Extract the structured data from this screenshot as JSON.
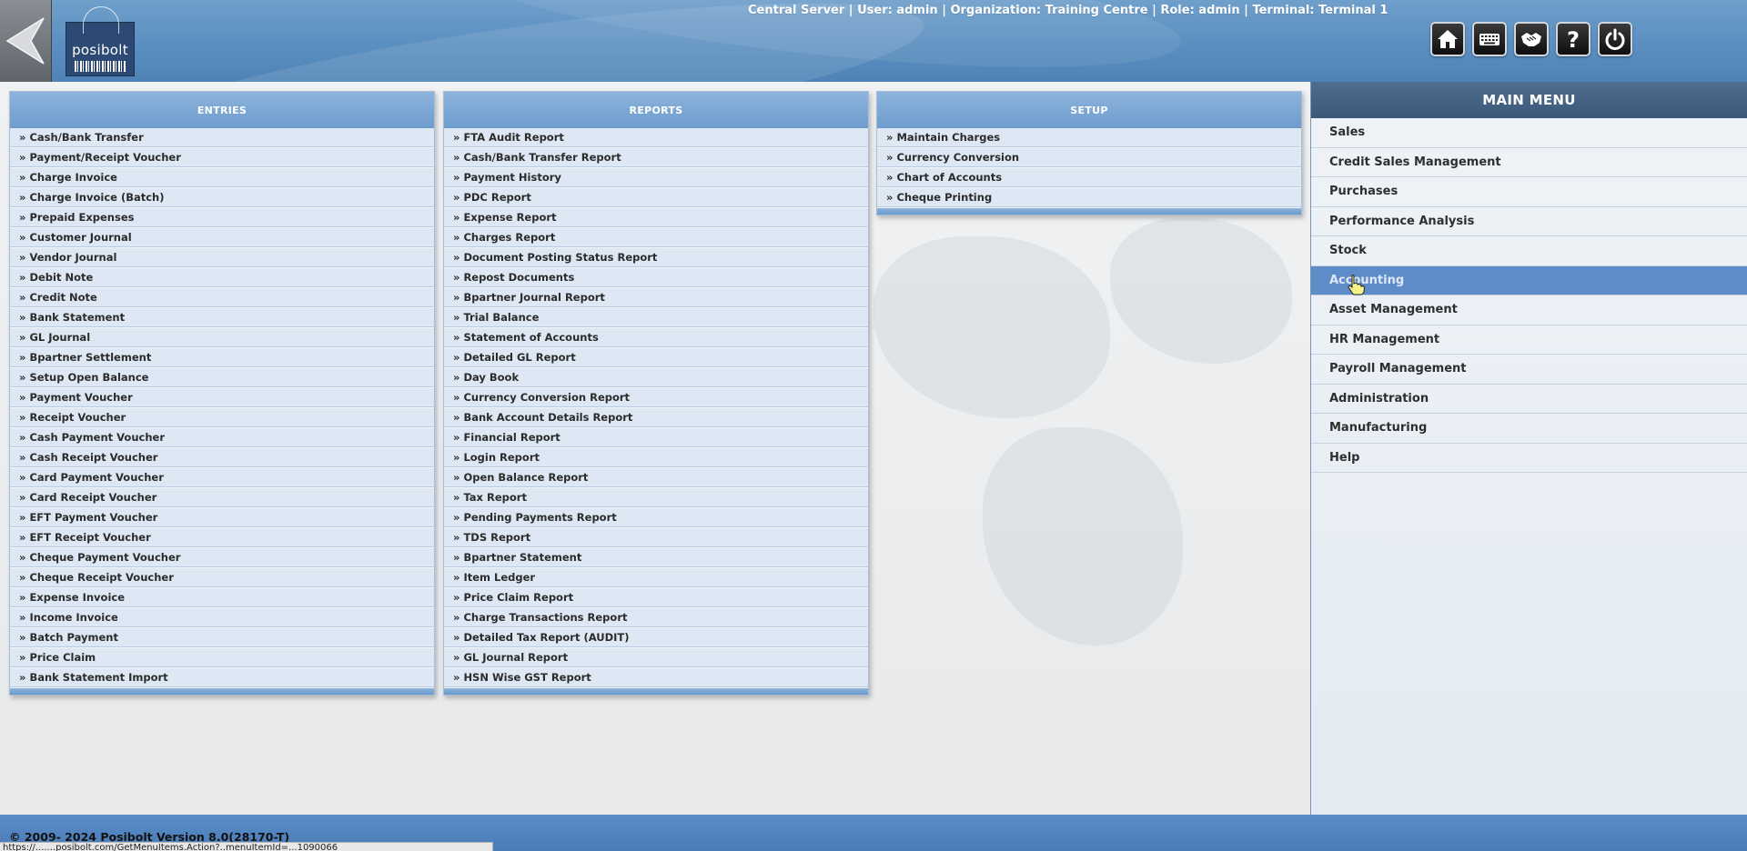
{
  "header": {
    "session_info": "Central Server | User: admin | Organization: Training Centre | Role: admin | Terminal: Terminal 1",
    "logo_text": "posibolt",
    "toolbar": [
      {
        "icon": "home-icon"
      },
      {
        "icon": "keyboard-icon"
      },
      {
        "icon": "handshake-icon"
      },
      {
        "icon": "help-icon"
      },
      {
        "icon": "power-icon"
      }
    ]
  },
  "panels": {
    "entries": {
      "title": "ENTRIES",
      "items": [
        "Cash/Bank Transfer",
        "Payment/Receipt Voucher",
        "Charge Invoice",
        "Charge Invoice (Batch)",
        "Prepaid Expenses",
        "Customer Journal",
        "Vendor Journal",
        "Debit Note",
        "Credit Note",
        "Bank Statement",
        "GL Journal",
        "Bpartner Settlement",
        "Setup Open Balance",
        "Payment Voucher",
        "Receipt Voucher",
        "Cash Payment Voucher",
        "Cash Receipt Voucher",
        "Card Payment Voucher",
        "Card Receipt Voucher",
        "EFT Payment Voucher",
        "EFT Receipt Voucher",
        "Cheque Payment Voucher",
        "Cheque Receipt Voucher",
        "Expense Invoice",
        "Income Invoice",
        "Batch Payment",
        "Price Claim",
        "Bank Statement Import"
      ]
    },
    "reports": {
      "title": "REPORTS",
      "items": [
        "FTA Audit Report",
        "Cash/Bank Transfer Report",
        "Payment History",
        "PDC Report",
        "Expense Report",
        "Charges Report",
        "Document Posting Status Report",
        "Repost Documents",
        "Bpartner Journal Report",
        "Trial Balance",
        "Statement of Accounts",
        "Detailed GL Report",
        "Day Book",
        "Currency Conversion Report",
        "Bank Account Details Report",
        "Financial Report",
        "Login Report",
        "Open Balance Report",
        "Tax Report",
        "Pending Payments Report",
        "TDS Report",
        "Bpartner Statement",
        "Item Ledger",
        "Price Claim Report",
        "Charge Transactions Report",
        "Detailed Tax Report (AUDIT)",
        "GL Journal Report",
        "HSN Wise GST Report"
      ]
    },
    "setup": {
      "title": "SETUP",
      "items": [
        "Maintain Charges",
        "Currency Conversion",
        "Chart of Accounts",
        "Cheque Printing"
      ]
    }
  },
  "main_menu": {
    "title": "MAIN MENU",
    "active_index": 5,
    "items": [
      "Sales",
      "Credit Sales Management",
      "Purchases",
      "Performance Analysis",
      "Stock",
      "Accounting",
      "Asset Management",
      "HR Management",
      "Payroll Management",
      "Administration",
      "Manufacturing",
      "Help"
    ]
  },
  "footer": {
    "copyright": "© 2009- 2024 Posibolt Version 8.0(28170-T)",
    "status_url": "https://.......posibolt.com/GetMenuItems.Action?..menuItemId=...1090066"
  },
  "colors": {
    "header_blue": "#5b8fc0",
    "panel_header": "#7aa6d4",
    "main_menu_header": "#45627f",
    "active_menu": "#5d8cc8"
  }
}
